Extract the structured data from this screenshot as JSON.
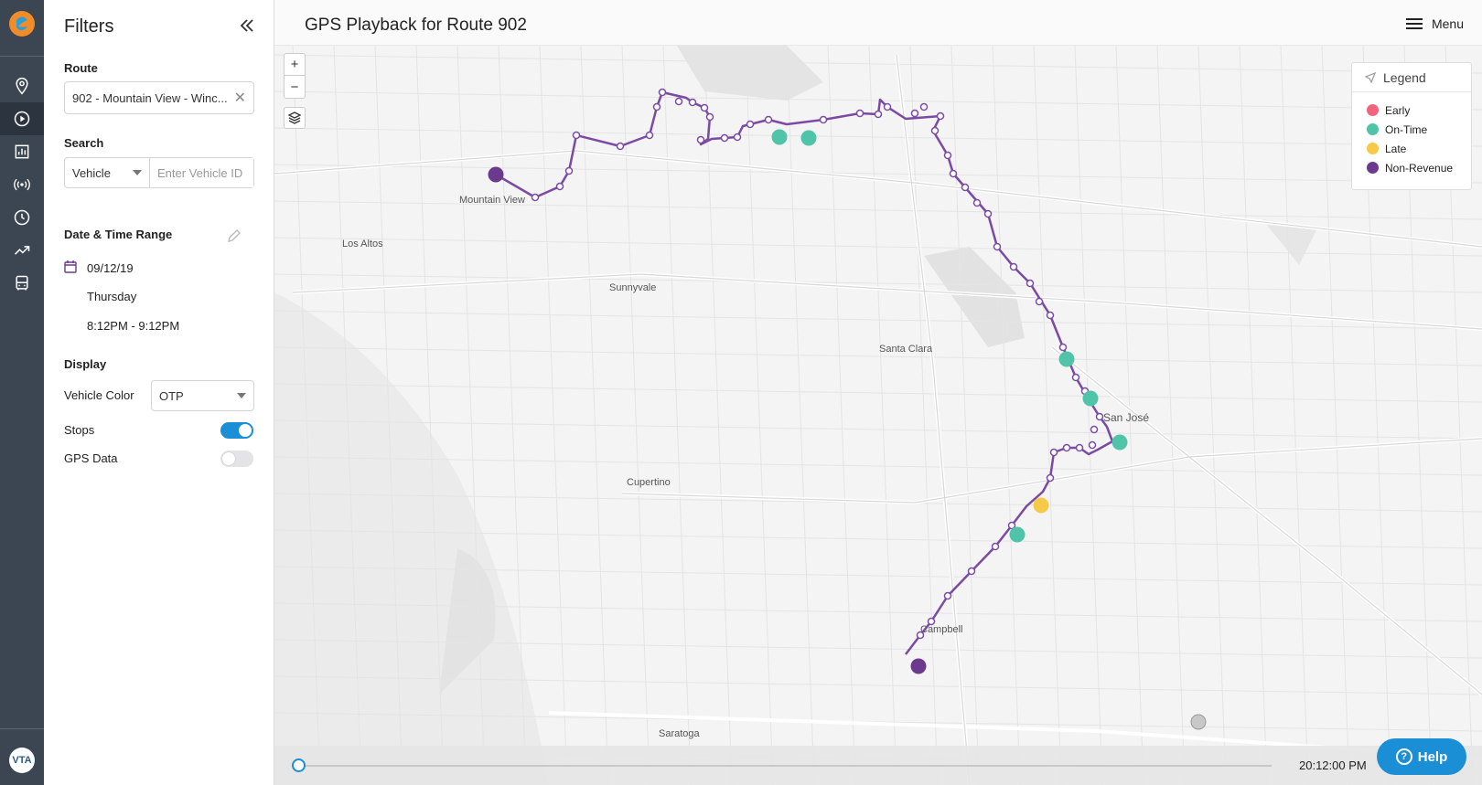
{
  "panel": {
    "title": "Filters",
    "route_label": "Route",
    "route_value": "902 - Mountain View - Winc...",
    "search_label": "Search",
    "search_type": "Vehicle",
    "search_placeholder": "Enter Vehicle ID",
    "datetime_label": "Date & Time Range",
    "date": "09/12/19",
    "weekday": "Thursday",
    "time_range": "8:12PM - 9:12PM",
    "display_label": "Display",
    "vehicle_color_label": "Vehicle Color",
    "vehicle_color_value": "OTP",
    "stops_label": "Stops",
    "stops_on": true,
    "gps_label": "GPS Data",
    "gps_on": false
  },
  "map": {
    "title": "GPS Playback for Route 902",
    "menu_label": "Menu",
    "zoom_in": "+",
    "zoom_out": "−",
    "legend_title": "Legend",
    "legend": [
      {
        "label": "Early",
        "color": "#f0657d"
      },
      {
        "label": "On-Time",
        "color": "#4fc4a9"
      },
      {
        "label": "Late",
        "color": "#f7c948"
      },
      {
        "label": "Non-Revenue",
        "color": "#6b3a8e"
      }
    ],
    "route_color": "#7b4aa3",
    "places": [
      {
        "name": "Mountain View"
      },
      {
        "name": "Los Altos"
      },
      {
        "name": "Sunnyvale"
      },
      {
        "name": "Santa Clara"
      },
      {
        "name": "San José"
      },
      {
        "name": "Cupertino"
      },
      {
        "name": "Campbell"
      },
      {
        "name": "Saratoga"
      }
    ],
    "playback_time": "20:12:00 PM",
    "playback_progress": 0,
    "help_label": "Help"
  }
}
